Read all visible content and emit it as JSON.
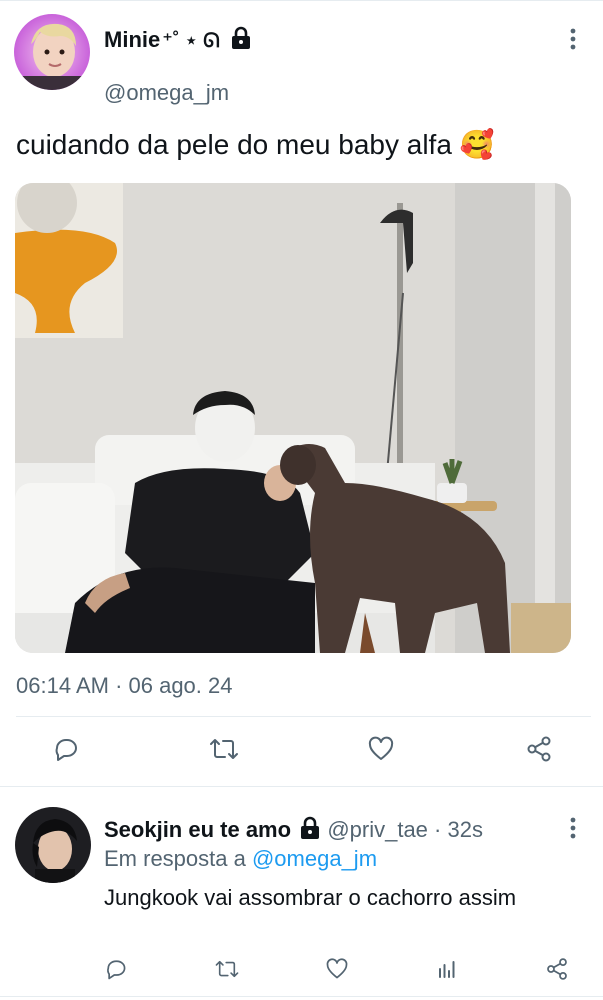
{
  "tweet": {
    "display_name": "Minie",
    "name_decor": "⁺˚ ⋆ ᘏ",
    "handle": "@omega_jm",
    "text": "cuidando da pele do meu baby alfa",
    "emoji": "🥰",
    "timestamp": "06:14 AM · 06 ago. 24",
    "more_icon": "kebab-vertical-icon",
    "verified_icon": "lock-icon"
  },
  "actions": [
    {
      "icon": "reply-icon"
    },
    {
      "icon": "retweet-icon"
    },
    {
      "icon": "like-icon"
    },
    {
      "icon": "share-icon"
    }
  ],
  "reply": {
    "display_name": "Seokjin eu te amo",
    "handle": "@priv_tae",
    "time": "· 32s",
    "in_reply_prefix": "Em resposta a",
    "in_reply_handle": "@omega_jm",
    "text": "Jungkook vai assombrar o cachorro assim",
    "actions": [
      {
        "icon": "reply-icon"
      },
      {
        "icon": "retweet-icon"
      },
      {
        "icon": "like-icon"
      },
      {
        "icon": "analytics-icon"
      },
      {
        "icon": "share-icon"
      }
    ]
  },
  "colors": {
    "text_primary": "#0f1419",
    "text_secondary": "#536471",
    "link": "#1d9bf0",
    "divider": "#e6ecf0"
  }
}
